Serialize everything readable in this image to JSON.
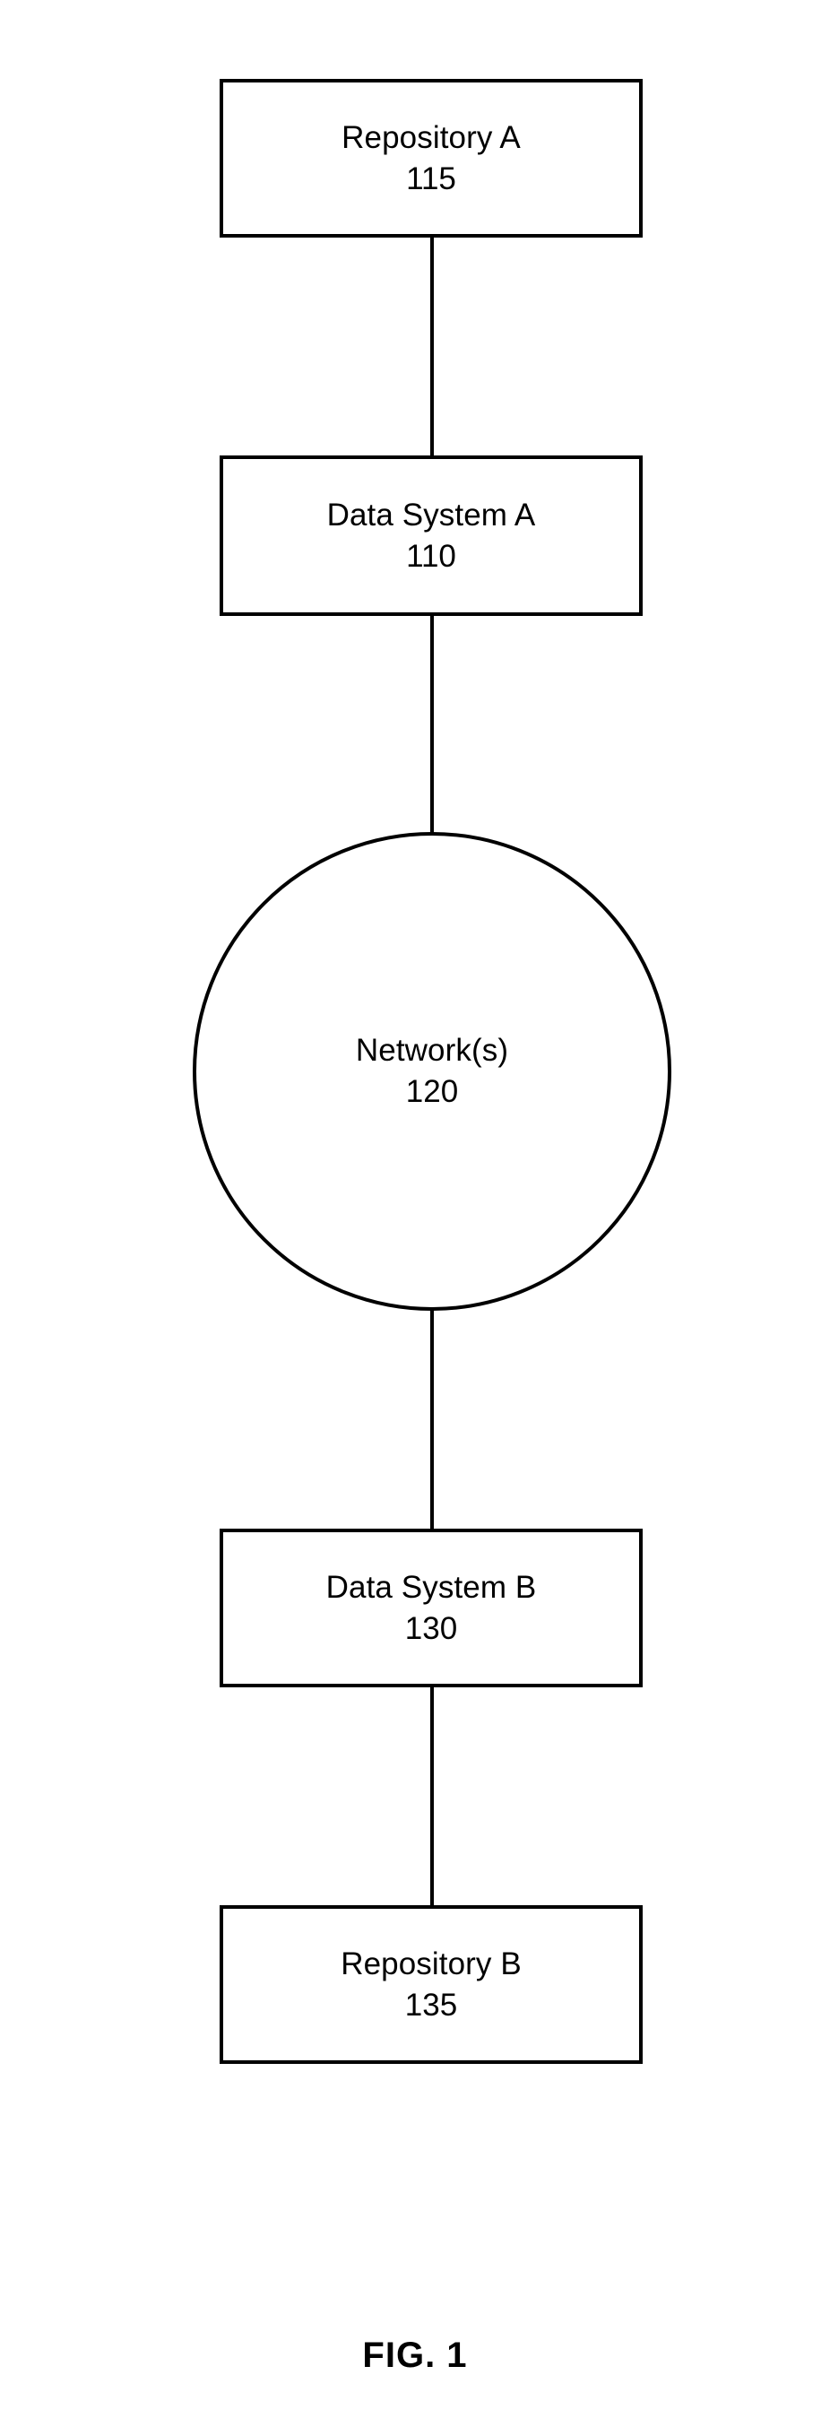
{
  "figure": {
    "caption": "FIG. 1",
    "background_color": "#ffffff",
    "line_color": "#000000",
    "text_color": "#000000"
  },
  "nodes": [
    {
      "id": "repository-a",
      "shape": "rectangle",
      "label": "Repository A",
      "reference_numeral": "115"
    },
    {
      "id": "data-system-a",
      "shape": "rectangle",
      "label": "Data System A",
      "reference_numeral": "110"
    },
    {
      "id": "network",
      "shape": "circle",
      "label": "Network(s)",
      "reference_numeral": "120"
    },
    {
      "id": "data-system-b",
      "shape": "rectangle",
      "label": "Data System B",
      "reference_numeral": "130"
    },
    {
      "id": "repository-b",
      "shape": "rectangle",
      "label": "Repository B",
      "reference_numeral": "135"
    }
  ],
  "connectors": [
    {
      "id": "connector-1",
      "from": "repository-a",
      "to": "data-system-a"
    },
    {
      "id": "connector-2",
      "from": "data-system-a",
      "to": "network"
    },
    {
      "id": "connector-3",
      "from": "network",
      "to": "data-system-b"
    },
    {
      "id": "connector-4",
      "from": "data-system-b",
      "to": "repository-b"
    }
  ]
}
